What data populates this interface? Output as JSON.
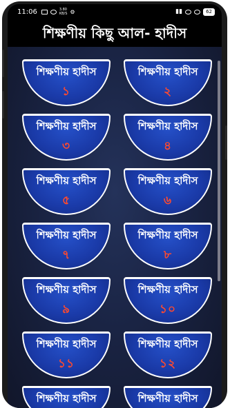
{
  "status_bar": {
    "time": "11:06",
    "network_speed": "3.80\nKB/S",
    "battery": "62"
  },
  "app": {
    "title": "শিক্ষণীয় কিছু আল- হাদীস"
  },
  "items": [
    {
      "title": "শিক্ষণীয় হাদীস",
      "number": "১"
    },
    {
      "title": "শিক্ষণীয় হাদীস",
      "number": "২"
    },
    {
      "title": "শিক্ষণীয় হাদীস",
      "number": "৩"
    },
    {
      "title": "শিক্ষণীয় হাদীস",
      "number": "৪"
    },
    {
      "title": "শিক্ষণীয় হাদীস",
      "number": "৫"
    },
    {
      "title": "শিক্ষণীয় হাদীস",
      "number": "৬"
    },
    {
      "title": "শিক্ষণীয় হাদীস",
      "number": "৭"
    },
    {
      "title": "শিক্ষণীয় হাদীস",
      "number": "৮"
    },
    {
      "title": "শিক্ষণীয় হাদীস",
      "number": "৯"
    },
    {
      "title": "শিক্ষণীয় হাদীস",
      "number": "১০"
    },
    {
      "title": "শিক্ষণীয় হাদীস",
      "number": "১১"
    },
    {
      "title": "শিক্ষণীয় হাদীস",
      "number": "১২"
    },
    {
      "title": "শিক্ষণীয় হাদীস"
    },
    {
      "title": "শিক্ষণীয় হাদীস"
    }
  ]
}
